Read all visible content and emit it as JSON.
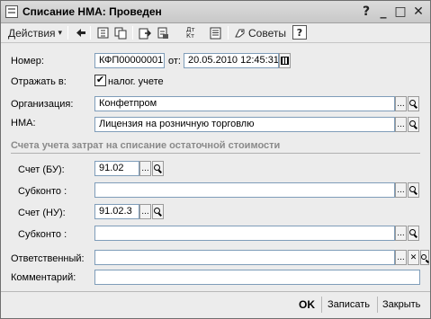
{
  "window": {
    "title": "Списание НМА: Проведен"
  },
  "toolbar": {
    "actions_label": "Действия",
    "actions_arrow": "▾",
    "tips_label": "Советы",
    "help_label": "?",
    "dt_kt_label": "Дт Кт",
    "icons": [
      "back-icon",
      "refresh-icon",
      "copy-icon",
      "post-icon",
      "unpost-icon",
      "dt-kt-icon",
      "report-icon",
      "tips-icon",
      "help-icon"
    ]
  },
  "form": {
    "number_label": "Номер:",
    "number_value": "КФП00000001",
    "date_label": "от:",
    "date_value": "20.05.2010 12:45:31",
    "reflect_label": "Отражать в:",
    "tax_accounting_label": "налог. учете",
    "tax_accounting_checked": true,
    "check_mark": "✔",
    "organization_label": "Организация:",
    "organization_value": "Конфетпром",
    "nma_label": "НМА:",
    "nma_value": "Лицензия на розничную торговлю",
    "section_title": "Счета учета затрат на списание остаточной стоимости",
    "account_bu_label": "Счет (БУ):",
    "account_bu_value": "91.02",
    "subconto_bu_label": "Субконто :",
    "subconto_bu_value": "",
    "account_nu_label": "Счет (НУ):",
    "account_nu_value": "91.02.3",
    "subconto_nu_label": "Субконто :",
    "subconto_nu_value": "",
    "responsible_label": "Ответственный:",
    "responsible_value": "",
    "comment_label": "Комментарий:",
    "comment_value": "",
    "select_glyph": "...",
    "clear_glyph": "✕"
  },
  "footer": {
    "ok_label": "OK",
    "save_label": "Записать",
    "close_label": "Закрыть"
  },
  "title_buttons": {
    "help": "?",
    "minimize": "_",
    "maximize": "□",
    "close": "✕"
  }
}
